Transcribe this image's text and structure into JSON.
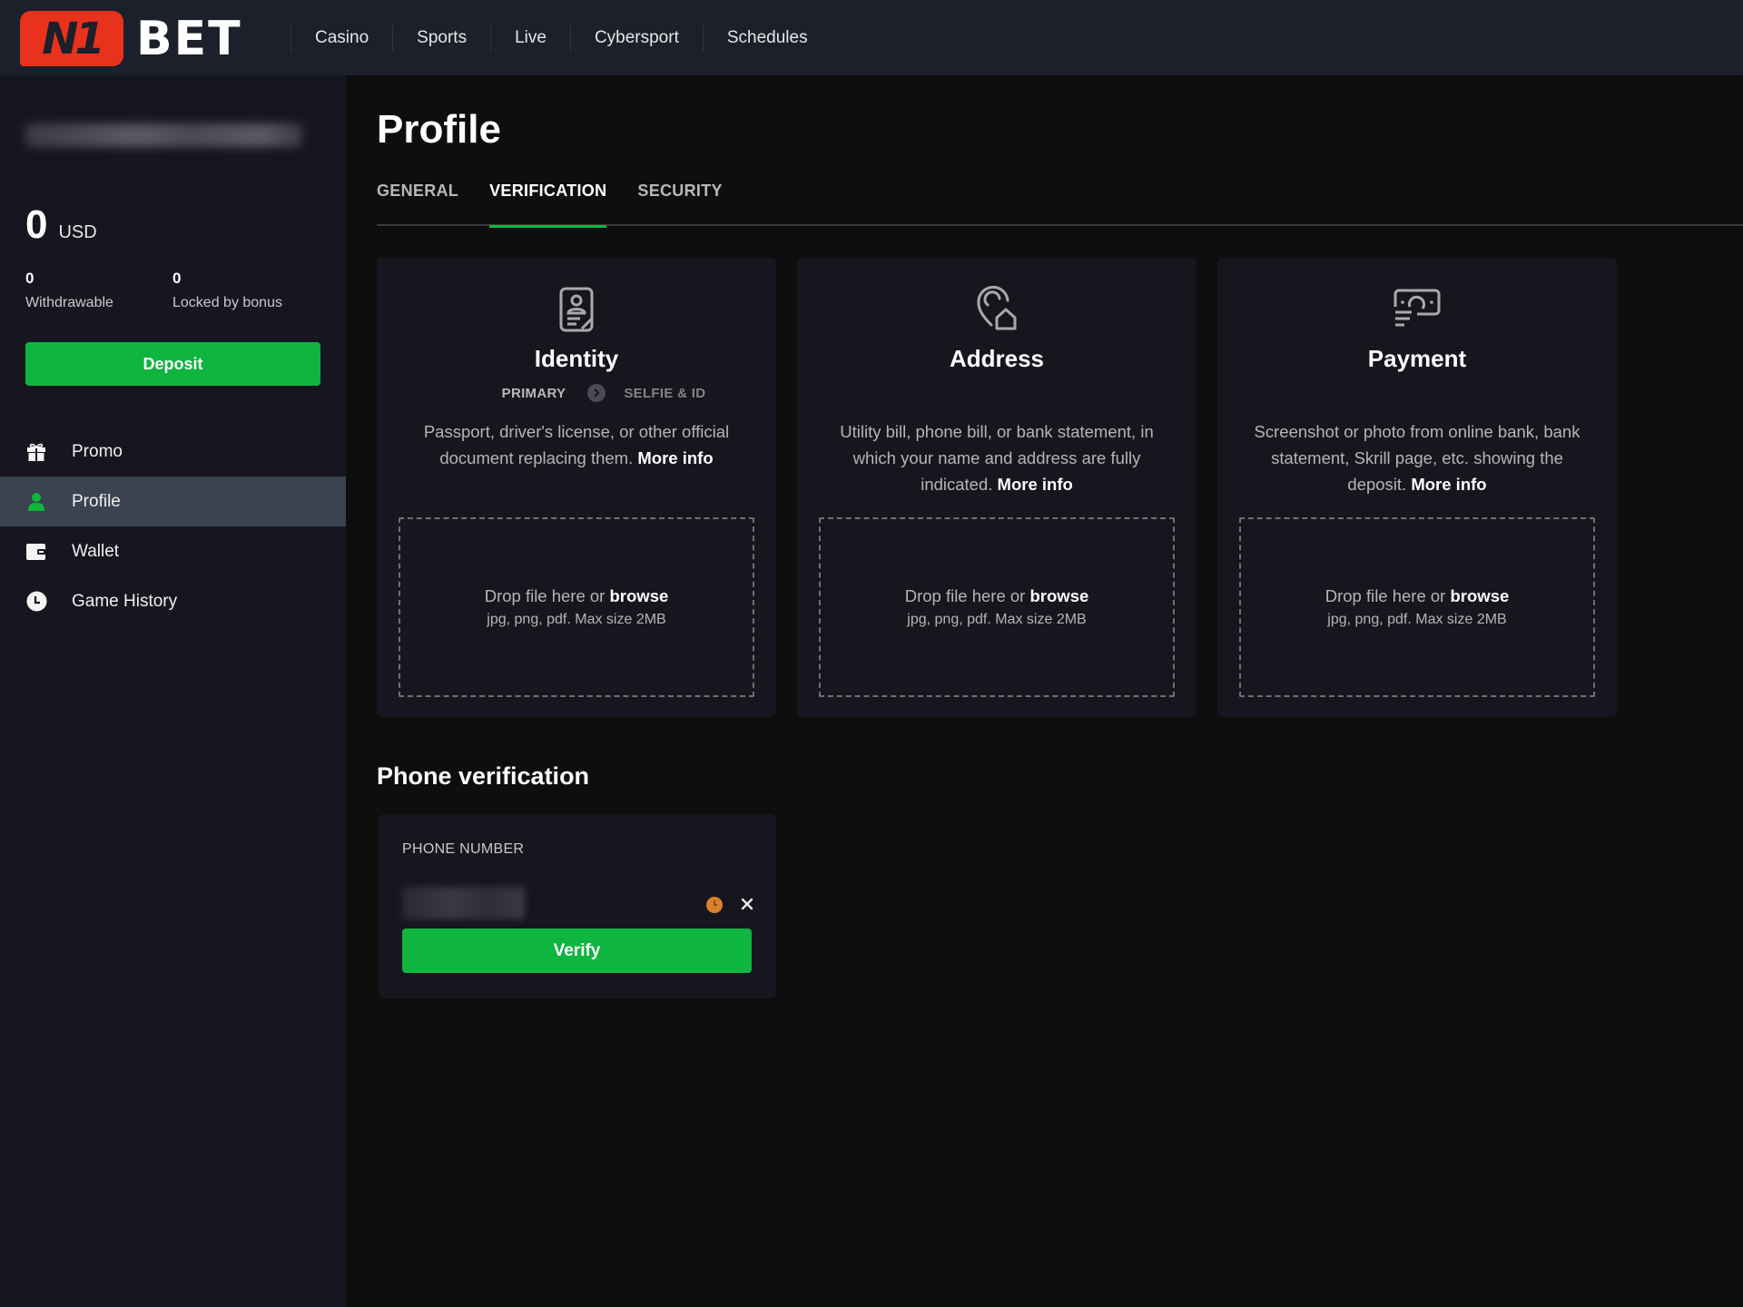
{
  "header": {
    "logo_mark": "N1",
    "logo_word": "BET",
    "nav": [
      "Casino",
      "Sports",
      "Live",
      "Cybersport",
      "Schedules"
    ],
    "brand_color": "#e8321c"
  },
  "sidebar": {
    "username": "[redacted]",
    "balance": {
      "amount": "0",
      "currency": "USD"
    },
    "withdrawable": {
      "value": "0",
      "label": "Withdrawable"
    },
    "locked": {
      "value": "0",
      "label": "Locked by bonus"
    },
    "deposit_label": "Deposit",
    "items": [
      {
        "label": "Promo",
        "icon": "gift-icon",
        "active": false
      },
      {
        "label": "Profile",
        "icon": "user-icon",
        "active": true
      },
      {
        "label": "Wallet",
        "icon": "wallet-icon",
        "active": false
      },
      {
        "label": "Game History",
        "icon": "clock-icon",
        "active": false
      }
    ]
  },
  "main": {
    "title": "Profile",
    "tabs": [
      {
        "label": "GENERAL",
        "active": false
      },
      {
        "label": "VERIFICATION",
        "active": true
      },
      {
        "label": "SECURITY",
        "active": false
      }
    ],
    "cards": [
      {
        "title": "Identity",
        "icon": "id-document-icon",
        "steps": {
          "primary": "PRIMARY",
          "secondary": "SELFIE & ID"
        },
        "description": "Passport, driver's license, or other official document replacing them.",
        "more_info": "More info",
        "drop_text": "Drop file here or",
        "browse": "browse",
        "formats": "jpg, png, pdf. Max size 2MB"
      },
      {
        "title": "Address",
        "icon": "location-home-icon",
        "description": "Utility bill, phone bill, or bank statement, in which your name and address are fully indicated.",
        "more_info": "More info",
        "drop_text": "Drop file here or",
        "browse": "browse",
        "formats": "jpg, png, pdf. Max size 2MB"
      },
      {
        "title": "Payment",
        "icon": "payment-icon",
        "description": "Screenshot or photo from online bank, bank statement, Skrill page, etc. showing the deposit.",
        "more_info": "More info",
        "drop_text": "Drop file here or",
        "browse": "browse",
        "formats": "jpg, png, pdf. Max size 2MB"
      }
    ],
    "phone": {
      "heading": "Phone verification",
      "label": "PHONE NUMBER",
      "value": "[redacted]",
      "status_icon": "pending-clock-icon",
      "verify_label": "Verify"
    },
    "accent_color": "#0eb53f"
  }
}
